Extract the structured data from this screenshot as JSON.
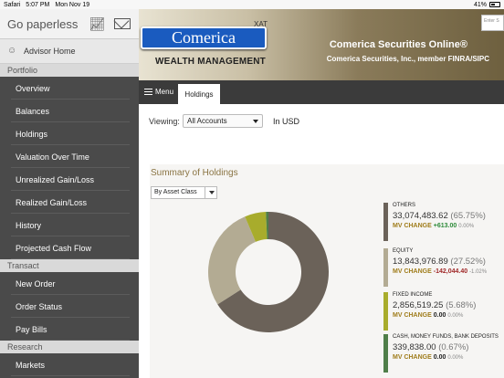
{
  "status_bar": {
    "carrier": "Safari",
    "time": "5:07 PM",
    "date": "Mon Nov 19",
    "battery": "41%"
  },
  "sidebar": {
    "go_paperless": "Go paperless",
    "advisor_home": "Advisor Home",
    "sections": [
      {
        "title": "Portfolio",
        "items": [
          "Overview",
          "Balances",
          "Holdings",
          "Valuation Over Time",
          "Unrealized Gain/Loss",
          "Realized Gain/Loss",
          "History",
          "Projected Cash Flow"
        ]
      },
      {
        "title": "Transact",
        "items": [
          "New Order",
          "Order Status",
          "Pay Bills"
        ]
      },
      {
        "title": "Research",
        "items": [
          "Markets"
        ]
      }
    ]
  },
  "banner": {
    "logo": "Comerica",
    "xat": "XAT",
    "wealth": "WEALTH MANAGEMENT",
    "title": "Comerica Securities Online®",
    "subtitle": "Comerica Securities, Inc., member FINRA/SIPC",
    "search_placeholder": "Enter S"
  },
  "tabbar": {
    "menu": "Menu",
    "active_tab": "Holdings"
  },
  "main": {
    "viewing_label": "Viewing:",
    "account_value": "All Accounts",
    "currency": "In USD",
    "summary_title": "Summary of Holdings",
    "group_by": "By Asset Class",
    "change_label": "MV CHANGE"
  },
  "colors": {
    "others": "#6b6259",
    "equity": "#b3ab93",
    "fixed_income": "#a8ac2c",
    "cash": "#4f7e49"
  },
  "holdings": [
    {
      "name": "OTHERS",
      "value": "33,074,483.62",
      "pct": "(65.75%)",
      "change": "+613.00",
      "change_pct": "0.00%",
      "trend": "pos",
      "share": 65.75,
      "color": "#6b6259"
    },
    {
      "name": "EQUITY",
      "value": "13,843,976.89",
      "pct": "(27.52%)",
      "change": "-142,044.40",
      "change_pct": "-1.02%",
      "trend": "neg",
      "share": 27.52,
      "color": "#b3ab93"
    },
    {
      "name": "FIXED INCOME",
      "value": "2,856,519.25",
      "pct": "(5.68%)",
      "change": "0.00",
      "change_pct": "0.00%",
      "trend": "neu",
      "share": 5.68,
      "color": "#a8ac2c"
    },
    {
      "name": "CASH, MONEY FUNDS, BANK DEPOSITS",
      "value": "339,838.00",
      "pct": "(0.67%)",
      "change": "0.00",
      "change_pct": "0.00%",
      "trend": "neu",
      "share": 0.67,
      "color": "#4f7e49"
    }
  ]
}
